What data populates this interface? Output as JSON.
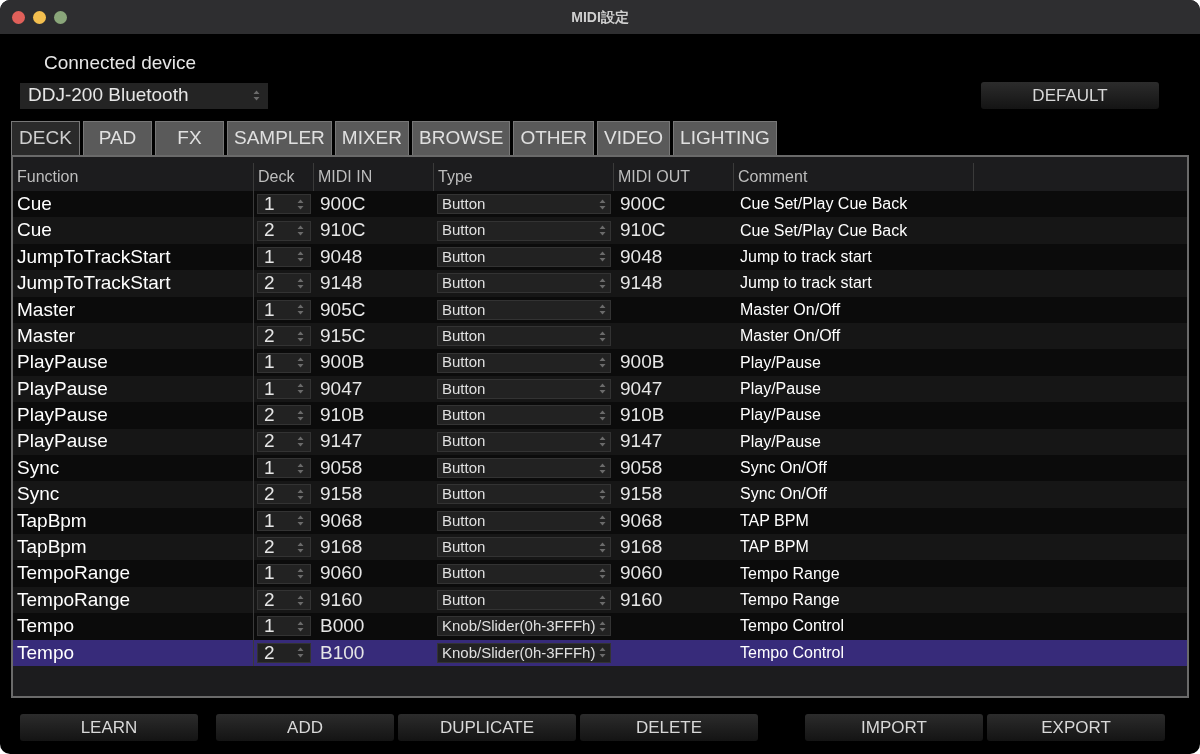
{
  "window": {
    "title": "MIDI設定"
  },
  "device": {
    "label": "Connected device",
    "value": "DDJ-200 Bluetooth"
  },
  "default_button": "DEFAULT",
  "tabs": [
    {
      "label": "DECK",
      "selected": true
    },
    {
      "label": "PAD",
      "selected": false
    },
    {
      "label": "FX",
      "selected": false
    },
    {
      "label": "SAMPLER",
      "selected": false
    },
    {
      "label": "MIXER",
      "selected": false
    },
    {
      "label": "BROWSE",
      "selected": false
    },
    {
      "label": "OTHER",
      "selected": false
    },
    {
      "label": "VIDEO",
      "selected": false
    },
    {
      "label": "LIGHTING",
      "selected": false
    }
  ],
  "table": {
    "columns": [
      "Function",
      "Deck",
      "MIDI IN",
      "Type",
      "MIDI OUT",
      "Comment"
    ],
    "rows": [
      {
        "function": "Cue",
        "deck": "1",
        "midi_in": "900C",
        "type": "Button",
        "midi_out": "900C",
        "comment": "Cue Set/Play Cue Back",
        "selected": false
      },
      {
        "function": "Cue",
        "deck": "2",
        "midi_in": "910C",
        "type": "Button",
        "midi_out": "910C",
        "comment": "Cue Set/Play Cue Back",
        "selected": false
      },
      {
        "function": "JumpToTrackStart",
        "deck": "1",
        "midi_in": "9048",
        "type": "Button",
        "midi_out": "9048",
        "comment": "Jump to track start",
        "selected": false
      },
      {
        "function": "JumpToTrackStart",
        "deck": "2",
        "midi_in": "9148",
        "type": "Button",
        "midi_out": "9148",
        "comment": "Jump to track start",
        "selected": false
      },
      {
        "function": "Master",
        "deck": "1",
        "midi_in": "905C",
        "type": "Button",
        "comment": "Master On/Off",
        "selected": false
      },
      {
        "function": "Master",
        "deck": "2",
        "midi_in": "915C",
        "type": "Button",
        "comment": "Master On/Off",
        "selected": false
      },
      {
        "function": "PlayPause",
        "deck": "1",
        "midi_in": "900B",
        "type": "Button",
        "midi_out": "900B",
        "comment": "Play/Pause",
        "selected": false
      },
      {
        "function": "PlayPause",
        "deck": "1",
        "midi_in": "9047",
        "type": "Button",
        "midi_out": "9047",
        "comment": "Play/Pause",
        "selected": false
      },
      {
        "function": "PlayPause",
        "deck": "2",
        "midi_in": "910B",
        "type": "Button",
        "midi_out": "910B",
        "comment": "Play/Pause",
        "selected": false
      },
      {
        "function": "PlayPause",
        "deck": "2",
        "midi_in": "9147",
        "type": "Button",
        "midi_out": "9147",
        "comment": "Play/Pause",
        "selected": false
      },
      {
        "function": "Sync",
        "deck": "1",
        "midi_in": "9058",
        "type": "Button",
        "midi_out": "9058",
        "comment": "Sync On/Off",
        "selected": false
      },
      {
        "function": "Sync",
        "deck": "2",
        "midi_in": "9158",
        "type": "Button",
        "midi_out": "9158",
        "comment": "Sync On/Off",
        "selected": false
      },
      {
        "function": "TapBpm",
        "deck": "1",
        "midi_in": "9068",
        "type": "Button",
        "midi_out": "9068",
        "comment": "TAP BPM",
        "selected": false
      },
      {
        "function": "TapBpm",
        "deck": "2",
        "midi_in": "9168",
        "type": "Button",
        "midi_out": "9168",
        "comment": "TAP BPM",
        "selected": false
      },
      {
        "function": "TempoRange",
        "deck": "1",
        "midi_in": "9060",
        "type": "Button",
        "midi_out": "9060",
        "comment": "Tempo Range",
        "selected": false
      },
      {
        "function": "TempoRange",
        "deck": "2",
        "midi_in": "9160",
        "type": "Button",
        "midi_out": "9160",
        "comment": "Tempo Range",
        "selected": false
      },
      {
        "function": "Tempo",
        "deck": "1",
        "midi_in": "B000",
        "type": "Knob/Slider(0h-3FFFh)",
        "comment": "Tempo Control",
        "selected": false
      },
      {
        "function": "Tempo",
        "deck": "2",
        "midi_in": "B100",
        "type": "Knob/Slider(0h-3FFFh)",
        "comment": "Tempo Control",
        "selected": true
      }
    ]
  },
  "buttons": [
    "LEARN",
    "ADD",
    "DUPLICATE",
    "DELETE",
    "IMPORT",
    "EXPORT"
  ]
}
